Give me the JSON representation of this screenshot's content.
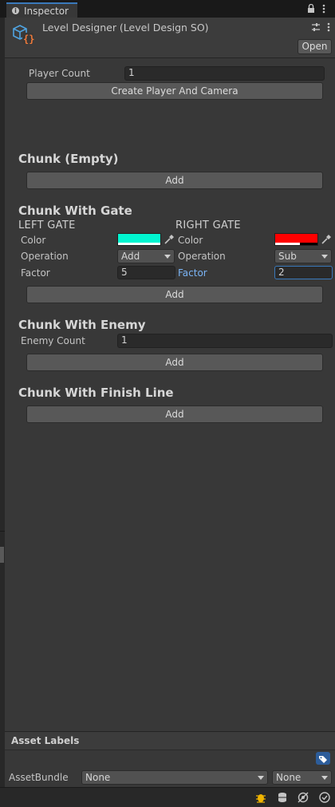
{
  "tab": {
    "title": "Inspector"
  },
  "header": {
    "title": "Level Designer (Level Design SO)",
    "open_label": "Open"
  },
  "player": {
    "label": "Player Count",
    "value": "1",
    "create_button": "Create Player And Camera"
  },
  "chunk_empty": {
    "title": "Chunk (Empty)",
    "add_label": "Add"
  },
  "chunk_gate": {
    "title": "Chunk With Gate",
    "left": {
      "heading": "LEFT GATE",
      "color_label": "Color",
      "color": "#00f5d0",
      "operation_label": "Operation",
      "operation": "Add",
      "factor_label": "Factor",
      "factor": "5"
    },
    "right": {
      "heading": "RIGHT GATE",
      "color_label": "Color",
      "color": "#ff0000",
      "operation_label": "Operation",
      "operation": "Sub",
      "factor_label": "Factor",
      "factor": "2"
    },
    "add_label": "Add"
  },
  "chunk_enemy": {
    "title": "Chunk With Enemy",
    "count_label": "Enemy Count",
    "count": "1",
    "add_label": "Add"
  },
  "chunk_finish": {
    "title": "Chunk With Finish Line",
    "add_label": "Add"
  },
  "asset_labels": {
    "title": "Asset Labels",
    "bundle_label": "AssetBundle",
    "bundle_value": "None",
    "variant_value": "None"
  },
  "colors": {
    "accent": "#3a79bb",
    "focus_label": "#7ab4f5"
  }
}
